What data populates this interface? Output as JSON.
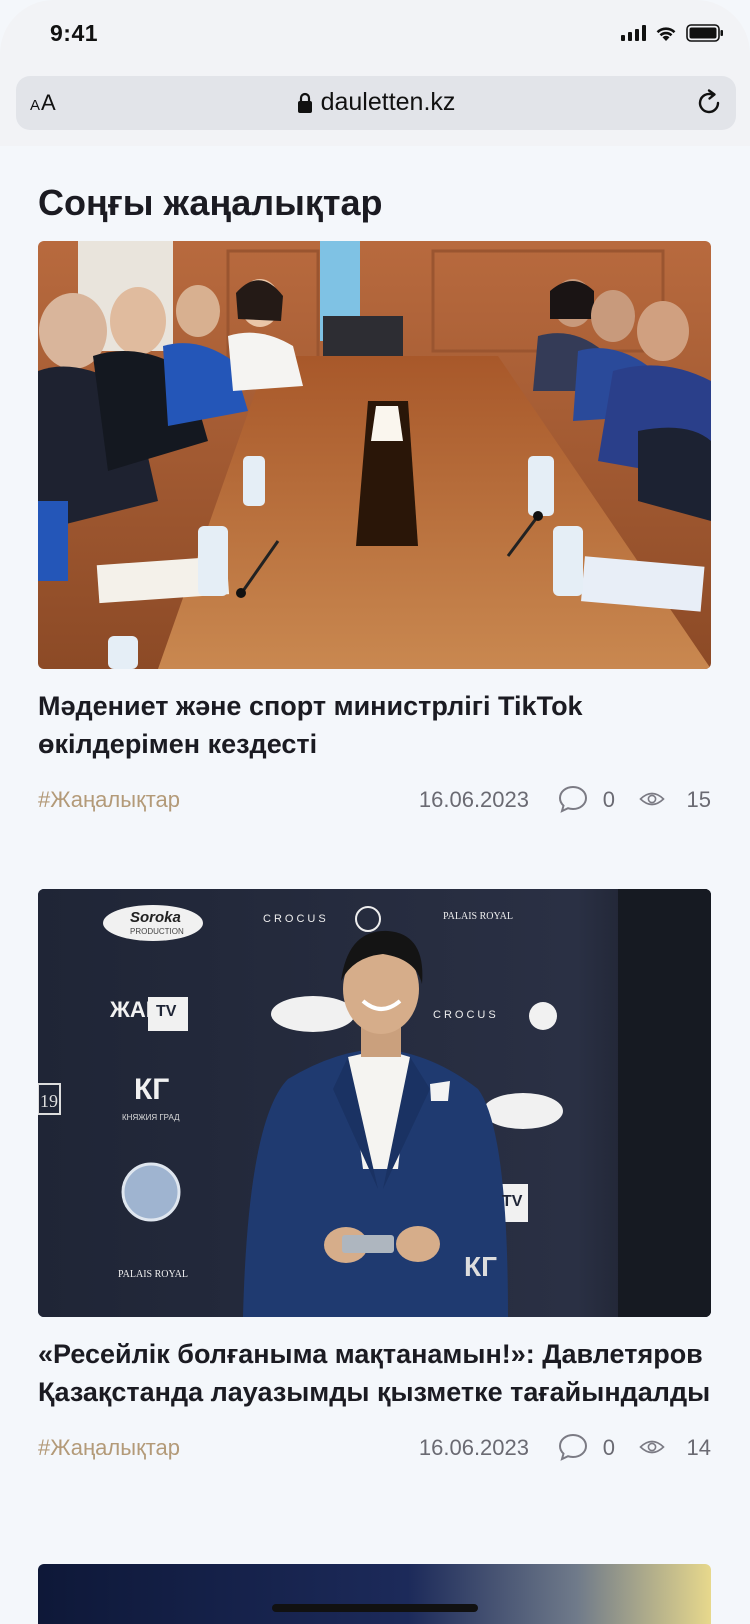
{
  "status_bar": {
    "time": "9:41"
  },
  "browser": {
    "text_size_label": "A",
    "text_size_small": "A",
    "url": "dauletten.kz"
  },
  "section": {
    "title": "Соңғы жаңалықтар"
  },
  "articles": [
    {
      "title": "Мәдениет және спорт министрлігі TikTok өкілдерімен кездесті",
      "tag": "#Жаңалықтар",
      "date": "16.06.2023",
      "comments": "0",
      "views": "15"
    },
    {
      "title": "«Ресейлік болғаныма мақтанамын!»: Давлетяров Қазақстанда лауазымды қызметке тағайындалды",
      "tag": "#Жаңалықтар",
      "date": "16.06.2023",
      "comments": "0",
      "views": "14"
    }
  ],
  "photo2_logos": {
    "soroka": "Soroka",
    "production": "PRODUCTION",
    "crocus": "CROCUS",
    "palais": "PALAIS ROYAL",
    "zhara": "ЖАРА",
    "tv": "TV",
    "kg": "КГ",
    "kg_sub": "КНЯЖИЯ ГРАД",
    "nineteen": "19"
  },
  "colors": {
    "accent_tag": "#b39a78",
    "meta_text": "#6a6a72",
    "background": "#f4f7fb"
  }
}
